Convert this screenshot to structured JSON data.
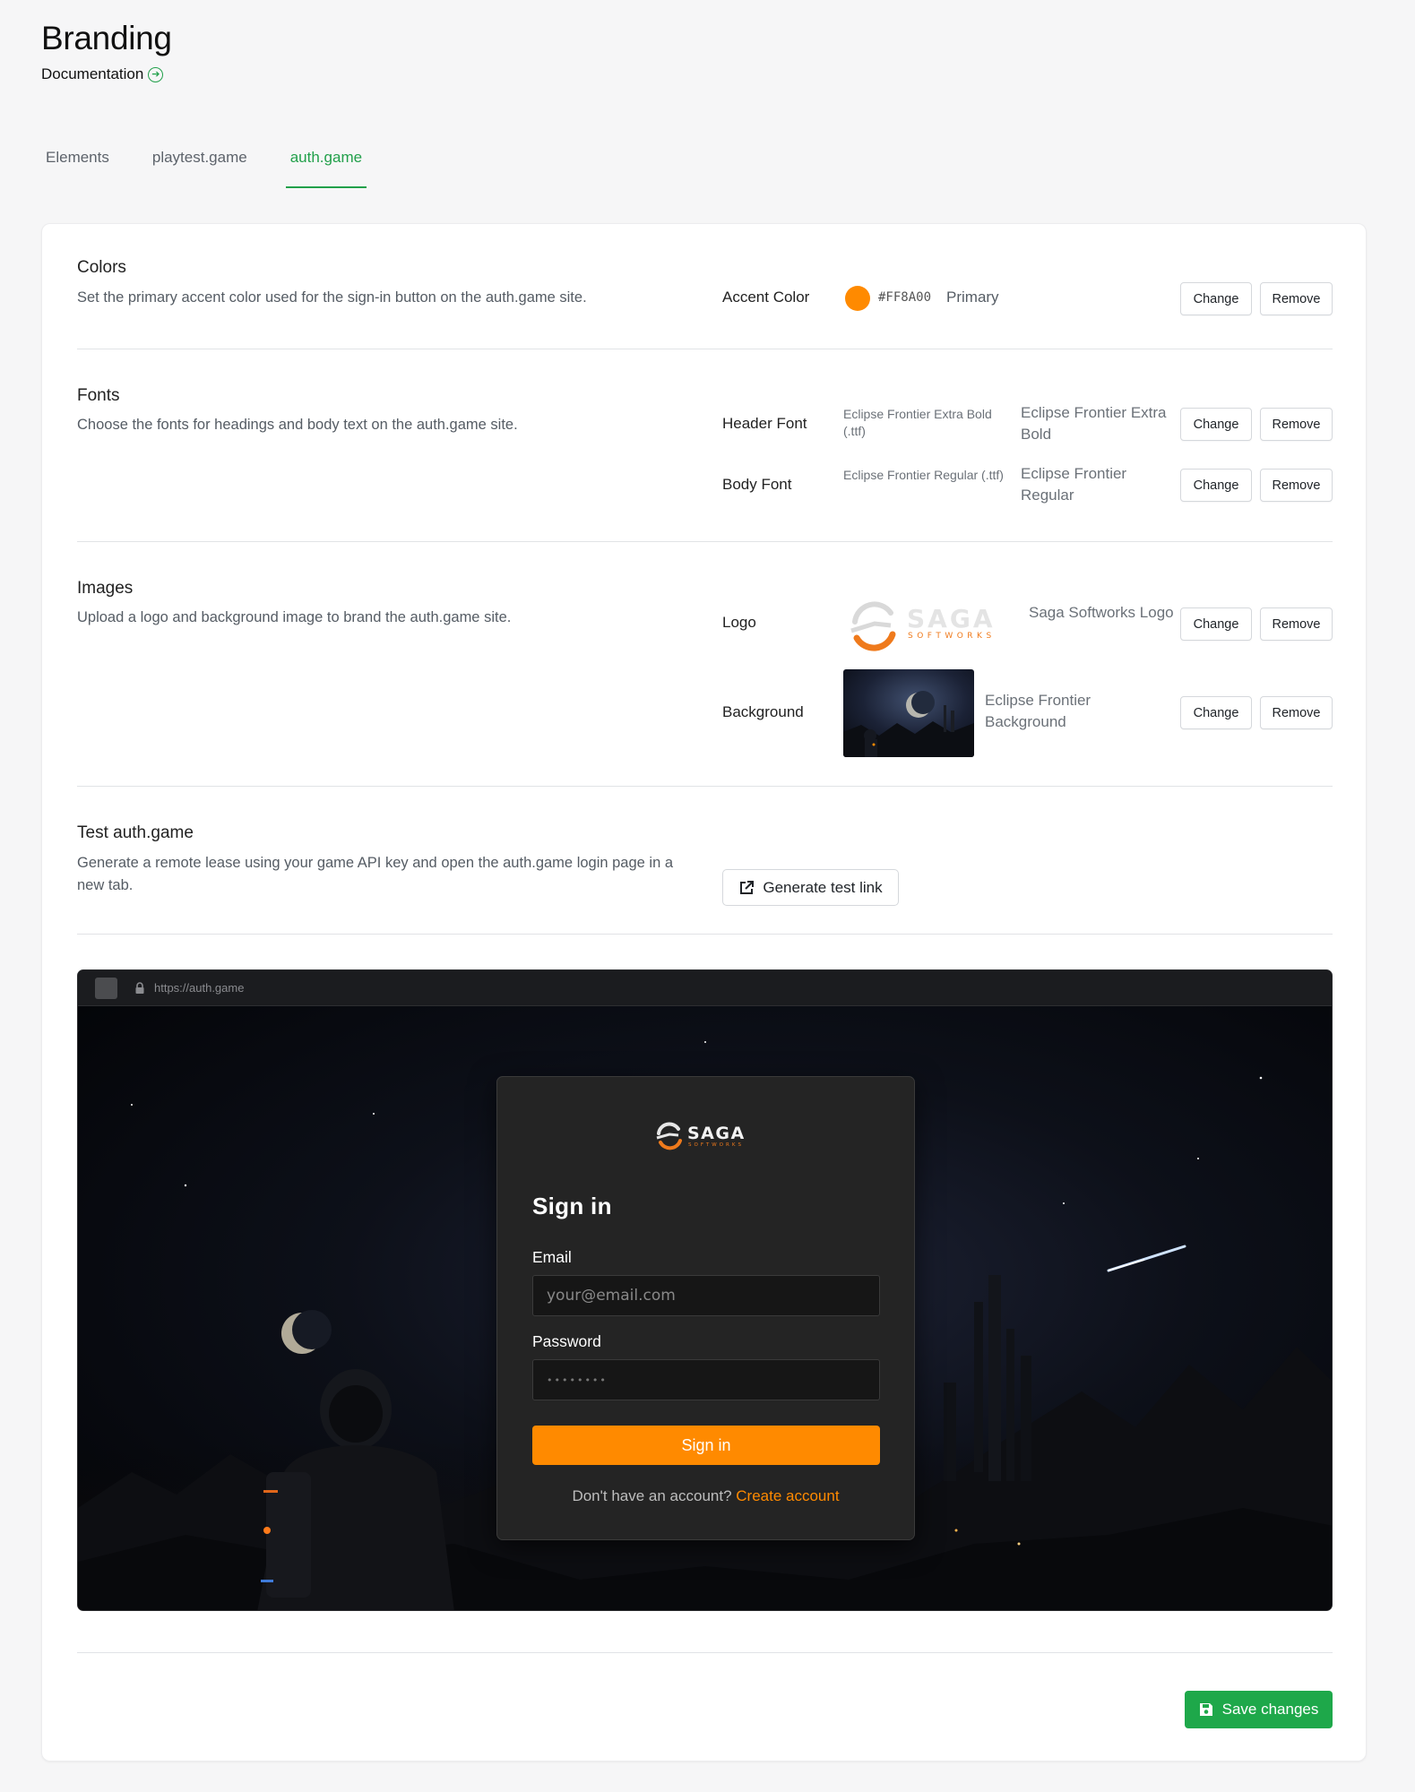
{
  "header": {
    "title": "Branding",
    "doc_link": "Documentation"
  },
  "tabs": [
    {
      "label": "Elements"
    },
    {
      "label": "playtest.game"
    },
    {
      "label": "auth.game"
    }
  ],
  "colors": {
    "title": "Colors",
    "desc": "Set the primary accent color used for the sign-in button on the auth.game site.",
    "label": "Accent Color",
    "hex": "#FF8A00",
    "name": "Primary",
    "swatch": "#ff8a00"
  },
  "fonts": {
    "title": "Fonts",
    "desc": "Choose the fonts for headings and body text on the auth.game site.",
    "header": {
      "label": "Header Font",
      "file": "Eclipse Frontier Extra Bold (.ttf)",
      "name": "Eclipse Frontier Extra Bold"
    },
    "body": {
      "label": "Body Font",
      "file": "Eclipse Frontier Regular (.ttf)",
      "name": "Eclipse Frontier Regular"
    }
  },
  "images": {
    "title": "Images",
    "desc": "Upload a logo and background image to brand the auth.game site.",
    "logo": {
      "label": "Logo",
      "name": "Saga Softworks Logo",
      "brand": "SAGA",
      "sub": "SOFTWORKS"
    },
    "background": {
      "label": "Background",
      "name": "Eclipse Frontier Background"
    }
  },
  "test": {
    "title": "Test auth.game",
    "desc": "Generate a remote lease using your game API key and open the auth.game login page in a new tab.",
    "button": "Generate test link"
  },
  "buttons": {
    "change": "Change",
    "remove": "Remove",
    "save": "Save changes"
  },
  "preview": {
    "url": "https://auth.game",
    "signin_title": "Sign in",
    "email_label": "Email",
    "email_placeholder": "your@email.com",
    "password_label": "Password",
    "password_value": "••••••••",
    "signin_button": "Sign in",
    "footer_text": "Don't have an account?",
    "footer_link": "Create account",
    "accent": "#ff8a00"
  }
}
